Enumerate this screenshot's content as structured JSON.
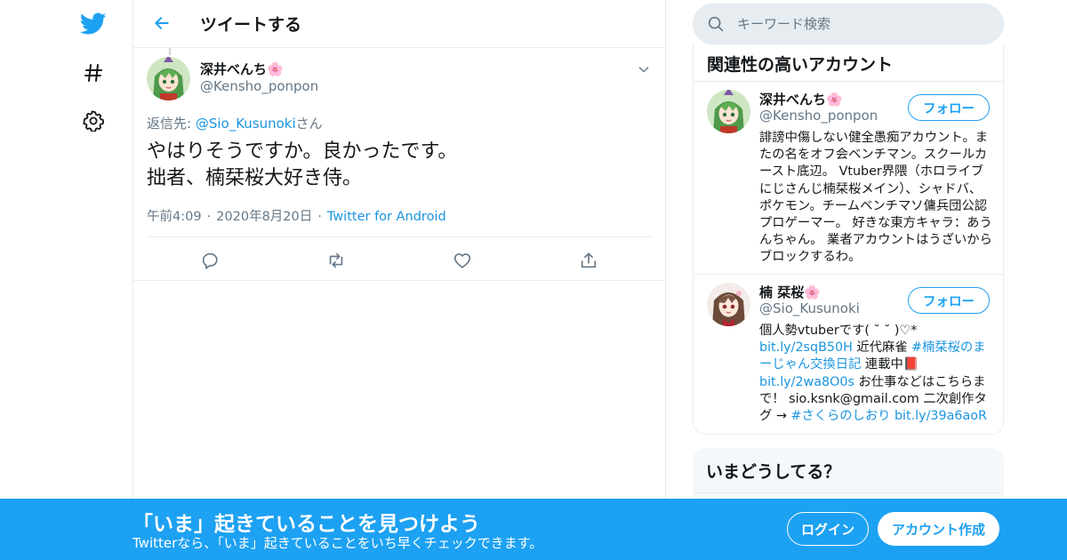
{
  "colors": {
    "brand": "#1da1f2",
    "link": "#1b95e0",
    "muted": "#657786",
    "text": "#14171a",
    "border": "#e6ecf0"
  },
  "nav": {
    "icons": [
      "twitter-logo-icon",
      "hashtag-icon",
      "gear-icon"
    ]
  },
  "header": {
    "title": "ツイートする",
    "back_icon": "arrow-left-icon"
  },
  "tweet": {
    "author_name": "深井べんち",
    "author_emoji": "🌸",
    "author_handle": "@Kensho_ponpon",
    "replying_prefix": "返信先: ",
    "replying_to": "@Sio_Kusunoki",
    "replying_suffix": "さん",
    "text": "やはりそうですか。良かったです。\n拙者、楠栞桜大好き侍。",
    "time": "午前4:09",
    "date": "2020年8月20日",
    "meta_separator": "·",
    "source": "Twitter for Android",
    "actions": [
      "reply-icon",
      "retweet-icon",
      "like-icon",
      "share-icon"
    ]
  },
  "search": {
    "placeholder": "キーワード検索"
  },
  "related": {
    "title": "関連性の高いアカウント",
    "follow_label": "フォロー",
    "accounts": [
      {
        "name": "深井べんち",
        "emoji": "🌸",
        "handle": "@Kensho_ponpon",
        "bio": "誹謗中傷しない健全愚痴アカウント。またの名をオフ会ベンチマン。スクールカースト底辺。 Vtuber界隈（ホロライブにじさんじ楠栞桜メイン）、シャドバ、ポケモン。チームベンチマソ傭兵団公認プロゲーマー。 好きな東方キャラ：あうんちゃん。 業者アカウントはうざいからブロックするわ。"
      },
      {
        "name": "楠 栞桜",
        "emoji": "🌸",
        "handle": "@Sio_Kusunoki",
        "bio_parts": [
          {
            "t": "個人勢vtuberです( ˘ ˘ )♡*"
          },
          {
            "br": true
          },
          {
            "t": "bit.ly/2sqB50H",
            "link": true
          },
          {
            "t": " 近代麻雀 "
          },
          {
            "t": "#楠栞桜のまーじゃん交換日記",
            "link": true
          },
          {
            "t": " 連載中📕"
          },
          {
            "br": true
          },
          {
            "t": "bit.ly/2wa8O0s",
            "link": true
          },
          {
            "t": " お仕事などはこちらまで！ sio.ksnk@gmail.com 二次創作タグ → "
          },
          {
            "t": "#さくらのしおり",
            "link": true
          },
          {
            "t": " "
          },
          {
            "t": "bit.ly/39a6aoR",
            "link": true
          }
        ]
      }
    ]
  },
  "trends": {
    "title": "いまどうしてる？"
  },
  "banner": {
    "title": "「いま」起きていることを見つけよう",
    "subtitle": "Twitterなら、「いま」起きていることをいち早くチェックできます。",
    "login_label": "ログイン",
    "signup_label": "アカウント作成"
  }
}
